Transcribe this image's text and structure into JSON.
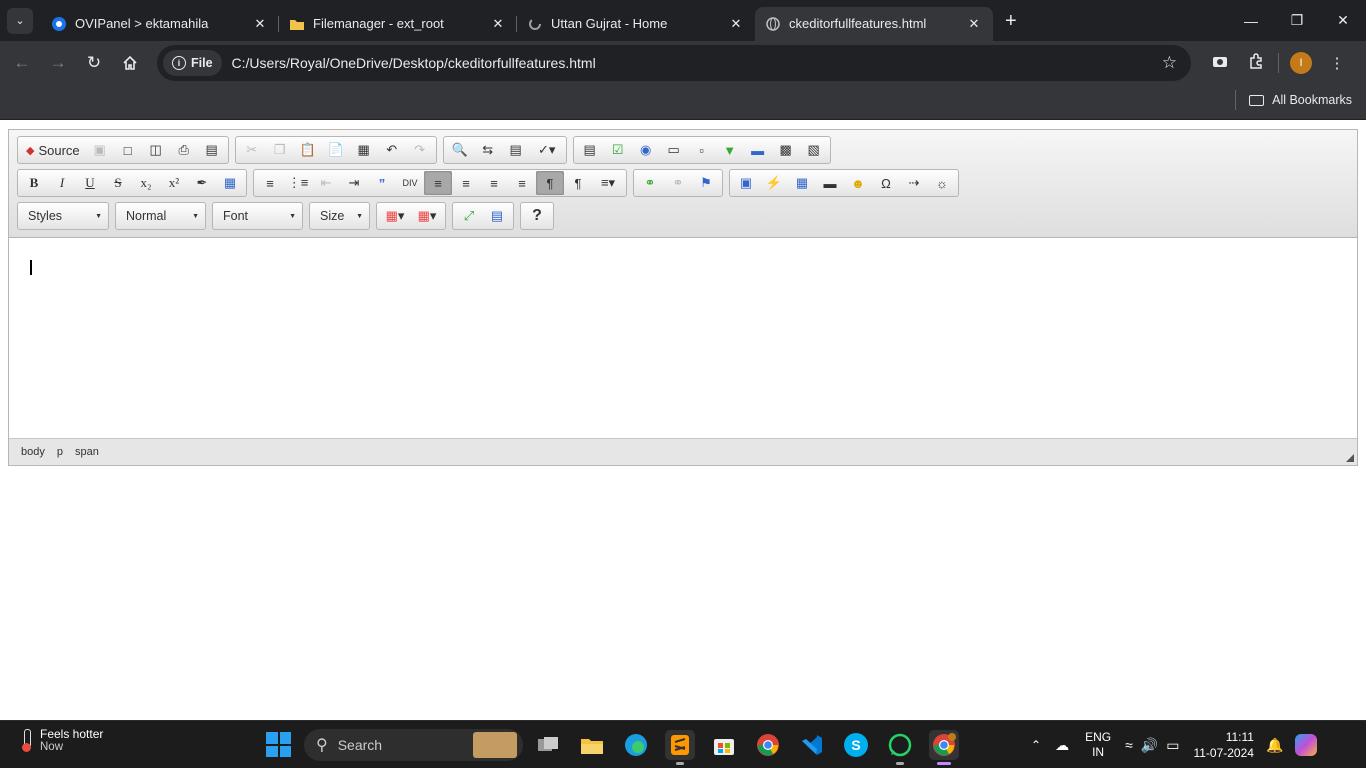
{
  "browser": {
    "tabs": [
      {
        "title": "OVIPanel > ektamahila",
        "favicon": "ovipanel-icon",
        "active": false
      },
      {
        "title": "Filemanager - ext_root",
        "favicon": "folder-icon",
        "active": false
      },
      {
        "title": "Uttan Gujrat - Home",
        "favicon": "spinner-icon",
        "active": false
      },
      {
        "title": "ckeditorfullfeatures.html",
        "favicon": "globe-icon",
        "active": true
      }
    ],
    "file_chip": "File",
    "url": "C:/Users/Royal/OneDrive/Desktop/ckeditorfullfeatures.html",
    "all_bookmarks": "All Bookmarks",
    "avatar_initial": "I"
  },
  "editor": {
    "source_label": "Source",
    "combos": {
      "styles": "Styles",
      "format": "Normal",
      "font": "Font",
      "size": "Size"
    },
    "help_label": "?",
    "path": [
      "body",
      "p",
      "span"
    ]
  },
  "taskbar": {
    "weather_title": "Feels hotter",
    "weather_sub": "Now",
    "search_label": "Search",
    "lang_top": "ENG",
    "lang_bottom": "IN",
    "time": "11:11",
    "date": "11-07-2024"
  },
  "colors": {
    "chrome_dark": "#202124",
    "chrome_toolbar": "#35363a",
    "accent_blue": "#2aa1f0",
    "avatar": "#c27b18"
  }
}
